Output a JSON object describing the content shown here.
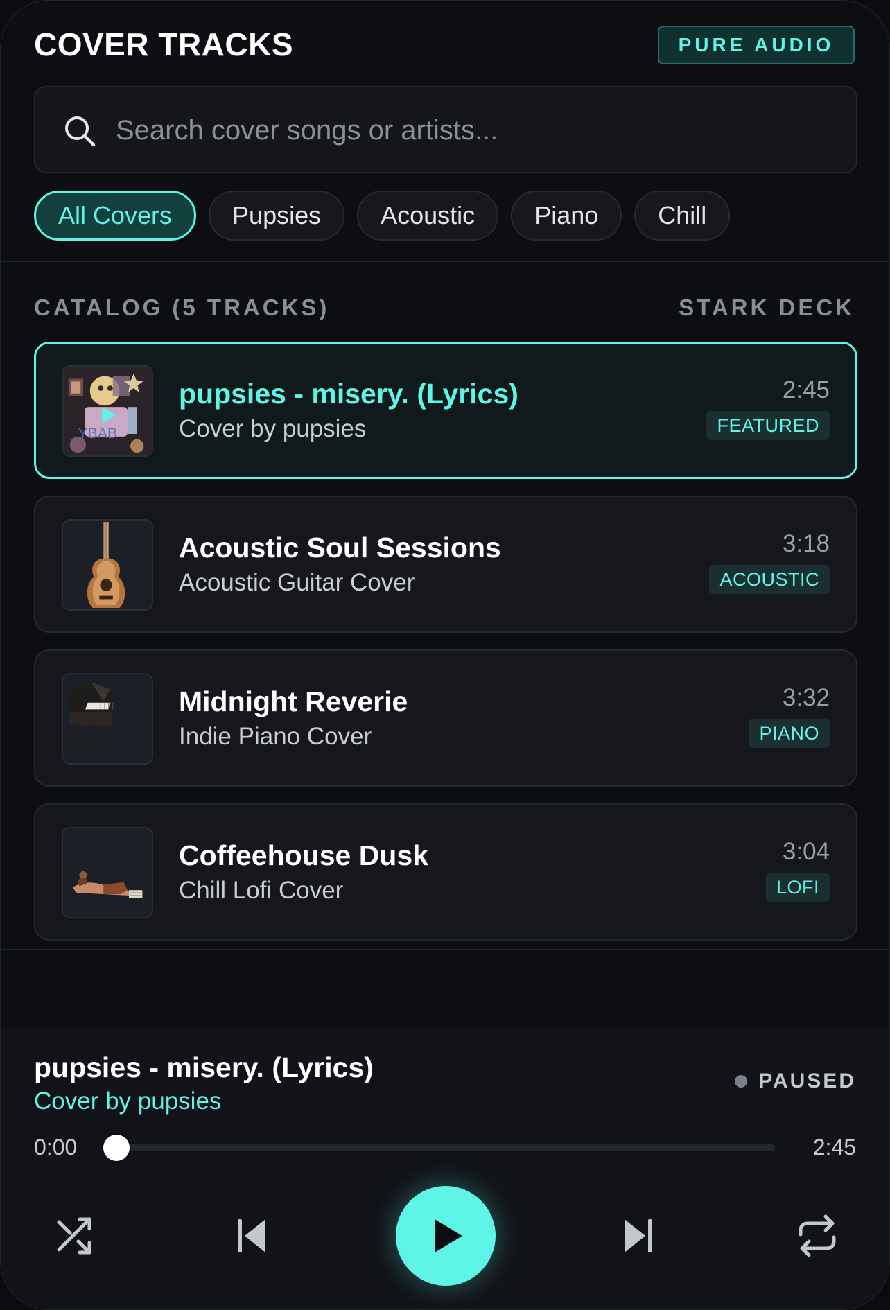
{
  "header": {
    "title": "COVER TRACKS",
    "badge": "PURE AUDIO"
  },
  "search": {
    "placeholder": "Search cover songs or artists...",
    "value": ""
  },
  "filters": [
    {
      "label": "All Covers",
      "active": true
    },
    {
      "label": "Pupsies",
      "active": false
    },
    {
      "label": "Acoustic",
      "active": false
    },
    {
      "label": "Piano",
      "active": false
    },
    {
      "label": "Chill",
      "active": false
    }
  ],
  "catalog": {
    "label": "CATALOG (5 TRACKS)",
    "deck_label": "STARK DECK",
    "tracks": [
      {
        "title": "pupsies - misery. (Lyrics)",
        "subtitle": "Cover by pupsies",
        "duration": "2:45",
        "tag": "FEATURED",
        "active": true,
        "art": "pupsies-album-art"
      },
      {
        "title": "Acoustic Soul Sessions",
        "subtitle": "Acoustic Guitar Cover",
        "duration": "3:18",
        "tag": "ACOUSTIC",
        "active": false,
        "art": "guitar-art"
      },
      {
        "title": "Midnight Reverie",
        "subtitle": "Indie Piano Cover",
        "duration": "3:32",
        "tag": "PIANO",
        "active": false,
        "art": "piano-art"
      },
      {
        "title": "Coffeehouse Dusk",
        "subtitle": "Chill Lofi Cover",
        "duration": "3:04",
        "tag": "LOFI",
        "active": false,
        "art": "lofi-art"
      }
    ]
  },
  "player": {
    "title": "pupsies - misery. (Lyrics)",
    "subtitle": "Cover by pupsies",
    "status": "PAUSED",
    "current_time": "0:00",
    "total_time": "2:45",
    "progress": 0.0,
    "controls": {
      "shuffle_icon": "shuffle-icon",
      "previous_icon": "skip-previous-icon",
      "play_icon": "play-icon",
      "next_icon": "skip-next-icon",
      "repeat_icon": "repeat-icon"
    }
  },
  "colors": {
    "accent": "#5ef5e6",
    "background": "#0d0e12",
    "card": "#15171c",
    "muted_text": "#8a8e96"
  }
}
